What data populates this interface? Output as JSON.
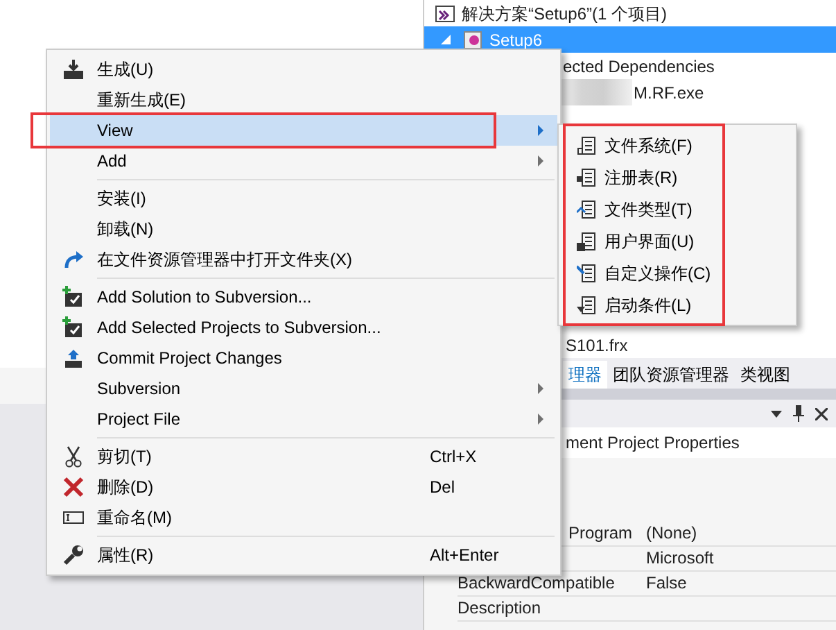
{
  "solution_explorer": {
    "tree": [
      {
        "label": "解决方案“Setup6”(1 个项目)",
        "selected": false,
        "children": [
          {
            "label": "Setup6",
            "selected": true,
            "expanded": true,
            "children": [
              {
                "label": "ected Dependencies",
                "selected": false
              },
              {
                "label": "M.RF.exe",
                "selected": false
              },
              {
                "label": "S101.frx",
                "selected": false
              }
            ]
          }
        ]
      }
    ],
    "tabs": [
      {
        "label": "理器",
        "selected": true
      },
      {
        "label": "团队资源管理器",
        "selected": false
      },
      {
        "label": "类视图",
        "selected": false
      }
    ]
  },
  "properties": {
    "object": "ment Project Properties",
    "rows": [
      {
        "name": "Program",
        "value": "(None)",
        "cut": true
      },
      {
        "name": "",
        "value": "Microsoft"
      },
      {
        "name": "BackwardCompatible",
        "value": "False"
      },
      {
        "name": "Description",
        "value": ""
      }
    ]
  },
  "context_menu": {
    "items": [
      {
        "kind": "item",
        "label": "生成(U)",
        "highlighted": false,
        "submenu": false
      },
      {
        "kind": "item",
        "label": "重新生成(E)",
        "highlighted": false,
        "submenu": false
      },
      {
        "kind": "item",
        "label": "View",
        "highlighted": true,
        "submenu": true
      },
      {
        "kind": "item",
        "label": "Add",
        "highlighted": false,
        "submenu": true
      },
      {
        "kind": "separator"
      },
      {
        "kind": "item",
        "label": "安装(I)",
        "highlighted": false,
        "submenu": false
      },
      {
        "kind": "item",
        "label": "卸载(N)",
        "highlighted": false,
        "submenu": false
      },
      {
        "kind": "item",
        "label": "在文件资源管理器中打开文件夹(X)",
        "highlighted": false,
        "submenu": false
      },
      {
        "kind": "separator"
      },
      {
        "kind": "item",
        "label": "Add Solution to Subversion...",
        "highlighted": false,
        "submenu": false
      },
      {
        "kind": "item",
        "label": "Add Selected Projects to Subversion...",
        "highlighted": false,
        "submenu": false
      },
      {
        "kind": "item",
        "label": "Commit Project Changes",
        "highlighted": false,
        "submenu": false
      },
      {
        "kind": "item",
        "label": "Subversion",
        "highlighted": false,
        "submenu": true
      },
      {
        "kind": "item",
        "label": "Project File",
        "highlighted": false,
        "submenu": true
      },
      {
        "kind": "separator"
      },
      {
        "kind": "item",
        "label": "剪切(T)",
        "shortcut": "Ctrl+X",
        "highlighted": false,
        "submenu": false
      },
      {
        "kind": "item",
        "label": "删除(D)",
        "shortcut": "Del",
        "highlighted": false,
        "submenu": false
      },
      {
        "kind": "item",
        "label": "重命名(M)",
        "highlighted": false,
        "submenu": false
      },
      {
        "kind": "separator"
      },
      {
        "kind": "item",
        "label": "属性(R)",
        "shortcut": "Alt+Enter",
        "highlighted": false,
        "submenu": false
      }
    ]
  },
  "submenu": {
    "items": [
      {
        "label": "文件系统(F)"
      },
      {
        "label": "注册表(R)"
      },
      {
        "label": "文件类型(T)"
      },
      {
        "label": "用户界面(U)"
      },
      {
        "label": "自定义操作(C)"
      },
      {
        "label": "启动条件(L)"
      }
    ]
  }
}
